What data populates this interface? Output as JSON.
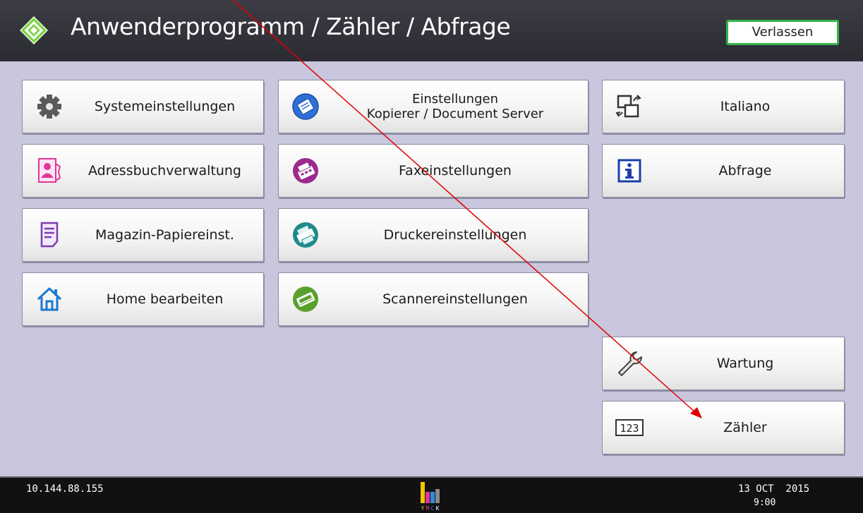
{
  "header": {
    "title": "Anwenderprogramm / Zähler / Abfrage",
    "exit_label": "Verlassen"
  },
  "menu": {
    "system": "Systemeinstellungen",
    "copier_line1": "Einstellungen",
    "copier_line2": "Kopierer / Document Server",
    "language": "Italiano",
    "addressbook": "Adressbuchverwaltung",
    "fax": "Faxeinstellungen",
    "inquiry": "Abfrage",
    "tray": "Magazin-Papiereinst.",
    "printer": "Druckereinstellungen",
    "home": "Home bearbeiten",
    "scanner": "Scannereinstellungen",
    "maintenance": "Wartung",
    "counter": "Zähler"
  },
  "icons": {
    "system": "gear-icon",
    "copier": "copier-icon",
    "language": "language-switch-icon",
    "addressbook": "address-book-icon",
    "fax": "fax-icon",
    "inquiry": "info-icon",
    "tray": "paper-tray-icon",
    "printer": "printer-icon",
    "home": "home-icon",
    "scanner": "scanner-icon",
    "maintenance": "wrench-icon",
    "counter": "counter-123-icon",
    "counter_text": "123"
  },
  "status": {
    "ip": "10.144.88.155",
    "date": "13 OCT  2015",
    "time": "9:00",
    "toner_letters": [
      "Y",
      "M",
      "C",
      "K"
    ]
  },
  "colors": {
    "background": "#c8c7de",
    "header": "#2a2a31",
    "exit_border": "#34b34a",
    "annotation_arrow": "#e00000",
    "copier_icon": "#2f6fd6",
    "fax_icon": "#9c2a8f",
    "printer_icon": "#1f8a8a",
    "scanner_icon": "#5aa02c",
    "addressbook_icon": "#e0359a",
    "tray_icon": "#7a3db0",
    "home_icon": "#1a78d0",
    "inquiry_icon": "#1a3fa8"
  }
}
